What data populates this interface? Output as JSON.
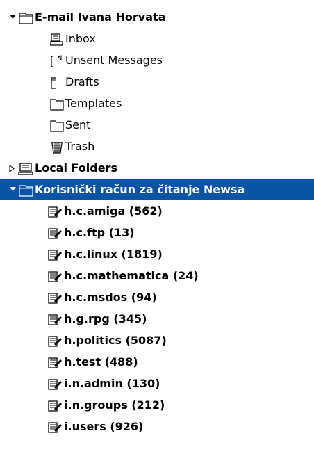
{
  "accounts": [
    {
      "label": "E-mail Ivana Horvata",
      "icon": "account-folder-icon",
      "folders": [
        {
          "label": "Inbox",
          "icon": "inbox-icon"
        },
        {
          "label": "Unsent Messages",
          "icon": "unsent-folder-icon"
        },
        {
          "label": "Drafts",
          "icon": "folder-icon"
        },
        {
          "label": "Templates",
          "icon": "folder-icon"
        },
        {
          "label": "Sent",
          "icon": "folder-icon"
        },
        {
          "label": "Trash",
          "icon": "trash-icon"
        }
      ]
    },
    {
      "label": "Local Folders",
      "icon": "computer-icon"
    },
    {
      "label": "Korisnički račun za čitanje Newsa",
      "icon": "account-folder-icon",
      "newsgroups": [
        {
          "label": "h.c.amiga (562)"
        },
        {
          "label": "h.c.ftp (13)"
        },
        {
          "label": "h.c.linux (1819)"
        },
        {
          "label": "h.c.mathematica (24)"
        },
        {
          "label": "h.c.msdos (94)"
        },
        {
          "label": "h.g.rpg (345)"
        },
        {
          "label": "h.politics (5087)"
        },
        {
          "label": "h.test (488)"
        },
        {
          "label": "i.n.admin (130)"
        },
        {
          "label": "i.n.groups (212)"
        },
        {
          "label": "i.users (926)"
        }
      ]
    }
  ],
  "colors": {
    "selection": "#0a54a8",
    "selection_text": "#ffffff"
  }
}
